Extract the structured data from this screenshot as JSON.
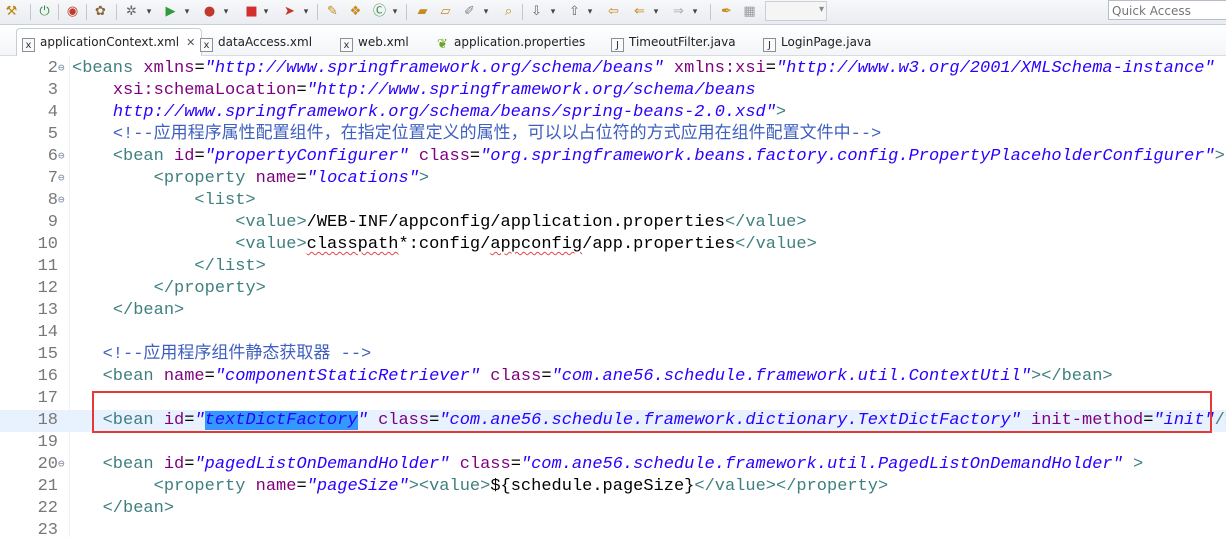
{
  "toolbar": {
    "icons": [
      "build-icon",
      "stop-debug-icon",
      "server-icon",
      "debug-icon",
      "run-icon",
      "run-config-icon",
      "external-tools-icon",
      "deploy-icon",
      "new-class-icon",
      "package-icon",
      "open-type-icon",
      "search-icon",
      "folder-open-icon",
      "next-annotation-icon",
      "prev-annotation-icon",
      "back-icon",
      "forward-icon",
      "pin-icon"
    ],
    "quick_access_placeholder": "Quick Access"
  },
  "tabs": [
    {
      "label": "applicationContext.xml",
      "icon": "xml-file-icon",
      "active": true,
      "close": "✕"
    },
    {
      "label": "dataAccess.xml",
      "icon": "xml-file-icon",
      "active": false
    },
    {
      "label": "web.xml",
      "icon": "xml-file-icon",
      "active": false
    },
    {
      "label": "application.properties",
      "icon": "properties-file-icon",
      "active": false
    },
    {
      "label": "TimeoutFilter.java",
      "icon": "java-file-icon",
      "active": false
    },
    {
      "label": "LoginPage.java",
      "icon": "java-file-icon",
      "active": false
    }
  ],
  "editor": {
    "lines": [
      {
        "n": "2",
        "fold": "⊖",
        "tokens": [
          [
            "tag",
            "<beans "
          ],
          [
            "attr",
            "xmlns"
          ],
          [
            "txt",
            "="
          ],
          [
            "val",
            "\"http://www.springframework.org/schema/beans\""
          ],
          [
            "txt",
            " "
          ],
          [
            "attr",
            "xmlns:xsi"
          ],
          [
            "txt",
            "="
          ],
          [
            "val",
            "\"http://www.w3.org/2001/XMLSchema-instance\""
          ]
        ]
      },
      {
        "n": "3",
        "fold": "",
        "tokens": [
          [
            "txt",
            "    "
          ],
          [
            "attr",
            "xsi:schemaLocation"
          ],
          [
            "txt",
            "="
          ],
          [
            "val",
            "\"http://www.springframework.org/schema/beans"
          ]
        ]
      },
      {
        "n": "4",
        "fold": "",
        "tokens": [
          [
            "txt",
            "    "
          ],
          [
            "val",
            "http://www.springframework.org/schema/beans/spring-beans-2.0.xsd\""
          ],
          [
            "tag",
            ">"
          ]
        ]
      },
      {
        "n": "5",
        "fold": "",
        "tokens": [
          [
            "txt",
            "    "
          ],
          [
            "cmt",
            "<!--应用程序属性配置组件，在指定位置定义的属性，可以以占位符的方式应用在组件配置文件中-->"
          ]
        ]
      },
      {
        "n": "6",
        "fold": "⊖",
        "tokens": [
          [
            "txt",
            "    "
          ],
          [
            "tag",
            "<bean "
          ],
          [
            "attr",
            "id"
          ],
          [
            "txt",
            "="
          ],
          [
            "val",
            "\"propertyConfigurer\""
          ],
          [
            "txt",
            " "
          ],
          [
            "attr",
            "class"
          ],
          [
            "txt",
            "="
          ],
          [
            "val",
            "\"org.springframework.beans.factory.config.PropertyPlaceholderConfigurer\""
          ],
          [
            "tag",
            ">"
          ]
        ]
      },
      {
        "n": "7",
        "fold": "⊖",
        "tokens": [
          [
            "txt",
            "        "
          ],
          [
            "tag",
            "<property "
          ],
          [
            "attr",
            "name"
          ],
          [
            "txt",
            "="
          ],
          [
            "val",
            "\"locations\""
          ],
          [
            "tag",
            ">"
          ]
        ]
      },
      {
        "n": "8",
        "fold": "⊖",
        "tokens": [
          [
            "txt",
            "            "
          ],
          [
            "tag",
            "<list>"
          ]
        ]
      },
      {
        "n": "9",
        "fold": "",
        "tokens": [
          [
            "txt",
            "                "
          ],
          [
            "tag",
            "<value>"
          ],
          [
            "txt",
            "/WEB-INF/appconfig/application.properties"
          ],
          [
            "tag",
            "</value>"
          ]
        ]
      },
      {
        "n": "10",
        "fold": "",
        "tokens": [
          [
            "txt",
            "                "
          ],
          [
            "tag",
            "<value>"
          ],
          [
            "squig",
            "classpath"
          ],
          [
            "txt",
            "*:config/"
          ],
          [
            "squig",
            "appconfig"
          ],
          [
            "txt",
            "/app.properties"
          ],
          [
            "tag",
            "</value>"
          ]
        ]
      },
      {
        "n": "11",
        "fold": "",
        "tokens": [
          [
            "txt",
            "            "
          ],
          [
            "tag",
            "</list>"
          ]
        ]
      },
      {
        "n": "12",
        "fold": "",
        "tokens": [
          [
            "txt",
            "        "
          ],
          [
            "tag",
            "</property>"
          ]
        ]
      },
      {
        "n": "13",
        "fold": "",
        "tokens": [
          [
            "txt",
            "    "
          ],
          [
            "tag",
            "</bean>"
          ]
        ]
      },
      {
        "n": "14",
        "fold": "",
        "tokens": []
      },
      {
        "n": "15",
        "fold": "",
        "tokens": [
          [
            "txt",
            "   "
          ],
          [
            "cmt",
            "<!--应用程序组件静态获取器 -->"
          ]
        ]
      },
      {
        "n": "16",
        "fold": "",
        "tokens": [
          [
            "txt",
            "   "
          ],
          [
            "tag",
            "<bean "
          ],
          [
            "attr",
            "name"
          ],
          [
            "txt",
            "="
          ],
          [
            "val",
            "\"componentStaticRetriever\""
          ],
          [
            "txt",
            " "
          ],
          [
            "attr",
            "class"
          ],
          [
            "txt",
            "="
          ],
          [
            "val",
            "\"com.ane56.schedule.framework.util.ContextUtil\""
          ],
          [
            "tag",
            "></bean>"
          ]
        ]
      },
      {
        "n": "17",
        "fold": "",
        "tokens": []
      },
      {
        "n": "18",
        "fold": "",
        "highlight": true,
        "tokens": [
          [
            "txt",
            "   "
          ],
          [
            "tag",
            "<bean "
          ],
          [
            "attr",
            "id"
          ],
          [
            "txt",
            "="
          ],
          [
            "val",
            "\""
          ],
          [
            "sel",
            "textDictFactory"
          ],
          [
            "val",
            "\""
          ],
          [
            "txt",
            " "
          ],
          [
            "attr",
            "class"
          ],
          [
            "txt",
            "="
          ],
          [
            "val",
            "\"com.ane56.schedule.framework.dictionary.TextDictFactory\""
          ],
          [
            "txt",
            " "
          ],
          [
            "attr",
            "init-method"
          ],
          [
            "txt",
            "="
          ],
          [
            "val",
            "\"init\""
          ],
          [
            "tag",
            "/>"
          ]
        ]
      },
      {
        "n": "19",
        "fold": "",
        "tokens": []
      },
      {
        "n": "20",
        "fold": "⊖",
        "tokens": [
          [
            "txt",
            "   "
          ],
          [
            "tag",
            "<bean "
          ],
          [
            "attr",
            "id"
          ],
          [
            "txt",
            "="
          ],
          [
            "val",
            "\"pagedListOnDemandHolder\""
          ],
          [
            "txt",
            " "
          ],
          [
            "attr",
            "class"
          ],
          [
            "txt",
            "="
          ],
          [
            "val",
            "\"com.ane56.schedule.framework.util.PagedListOnDemandHolder\""
          ],
          [
            "txt",
            " "
          ],
          [
            "tag",
            ">"
          ]
        ]
      },
      {
        "n": "21",
        "fold": "",
        "tokens": [
          [
            "txt",
            "        "
          ],
          [
            "tag",
            "<property "
          ],
          [
            "attr",
            "name"
          ],
          [
            "txt",
            "="
          ],
          [
            "val",
            "\"pageSize\""
          ],
          [
            "tag",
            "><value>"
          ],
          [
            "txt",
            "${schedule.pageSize}"
          ],
          [
            "tag",
            "</value></property>"
          ]
        ]
      },
      {
        "n": "22",
        "fold": "",
        "tokens": [
          [
            "txt",
            "   "
          ],
          [
            "tag",
            "</bean>"
          ]
        ]
      },
      {
        "n": "23",
        "fold": "",
        "tokens": []
      }
    ]
  }
}
